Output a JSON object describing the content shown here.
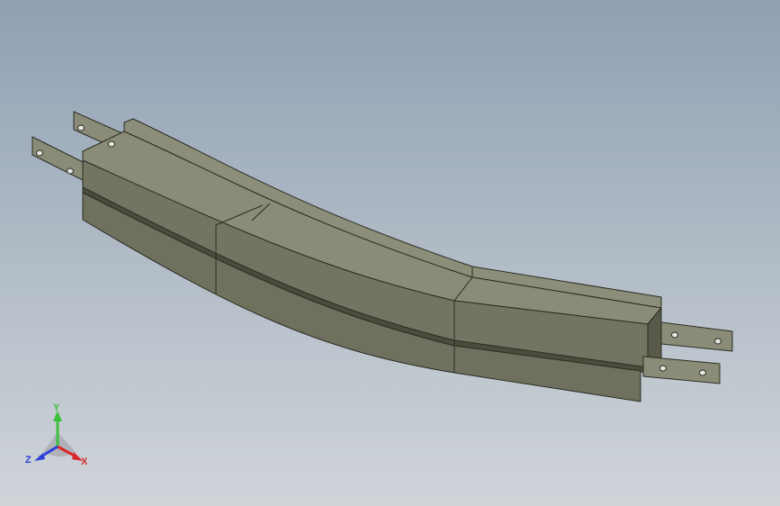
{
  "viewport": {
    "colors": {
      "bg_top": "#8fa0b3",
      "bg_bottom": "#cfd4d9"
    }
  },
  "model": {
    "colors": {
      "steel_top": "#8a8c77",
      "steel_side": "#737562",
      "steel_dark": "#585a4a",
      "edge": "#2c2c24"
    }
  },
  "triad": {
    "x_label": "X",
    "y_label": "Y",
    "z_label": "Z",
    "colors": {
      "x": "#d8292c",
      "y": "#3cc13c",
      "z": "#2b3fd8"
    }
  }
}
